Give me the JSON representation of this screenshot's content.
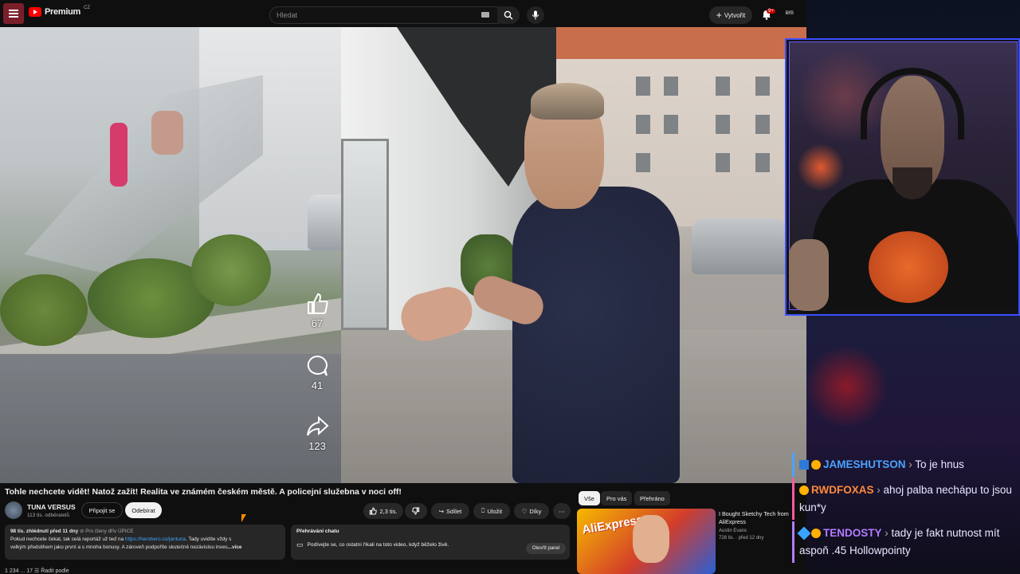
{
  "topbar": {
    "logo_text": "Premium",
    "country_code": "CZ",
    "search_placeholder": "Hledat",
    "create_label": "Vytvořit",
    "notifications_badge": "9+",
    "account_label": "ɃƗƁ"
  },
  "shorts_actions": {
    "likes": "67",
    "comments": "41",
    "shares": "123"
  },
  "video": {
    "title": "Tohle nechcete vidět! Natož zažít! Realita ve známém českém městě. A policejní služebna v noci off!",
    "channel_name": "TUNA VERSUS",
    "channel_subs": "113 tis. odběratelů",
    "join_label": "Připojit se",
    "subscribe_label": "Odebírat",
    "like_count": "2,3 tis.",
    "share_label": "Sdílet",
    "save_label": "Uložit",
    "thanks_label": "Díky",
    "more_label": "⋯"
  },
  "description": {
    "views": "98 tis. zhlédnutí",
    "date": "před 11 dny",
    "members_tag": "⊘ Pro členy dřív",
    "hashtag": "ÚPICE",
    "line1_prefix": "Pokud nechcete čekat, tak celá reportáž už teď na ",
    "link": "https://herohero.co/jantuna",
    "line1_suffix": ". Tady uvidíte vždy s",
    "line2": "velkým předstihem jako první a s mnoha bonusy. A zároveň podpoříte skutečně nezávislou inves",
    "more": "...více"
  },
  "chat_replay": {
    "title": "Přehrávání chatu",
    "text": "Podívejte se, co ostatní říkali na toto video, když běželo živě.",
    "open_label": "Otevřít panel"
  },
  "filters": [
    "Vše",
    "Pro vás",
    "Přehráno"
  ],
  "recommendation": {
    "title": "I Bought Sketchy Tech from",
    "title2": "AliExpress",
    "channel": "Austin Evans",
    "meta": "728 tis. · před 12 dny",
    "thumb_text": "AliExpress"
  },
  "stream_chat": [
    {
      "user": "JAMESHUTSON",
      "message": "To je hnus",
      "color": "#4aa3ff"
    },
    {
      "user": "RWDFOXAS",
      "message": "ahoj palba nechápu to jsou kun*y",
      "color": "#ff8a3c"
    },
    {
      "user": "TENDOSTY",
      "message": "tady je fakt nutnost mít aspoň .45 Hollowpointy",
      "color": "#b27cff"
    }
  ],
  "bottom_peek": "1 234 ... 17 ☰ Řadit podle"
}
